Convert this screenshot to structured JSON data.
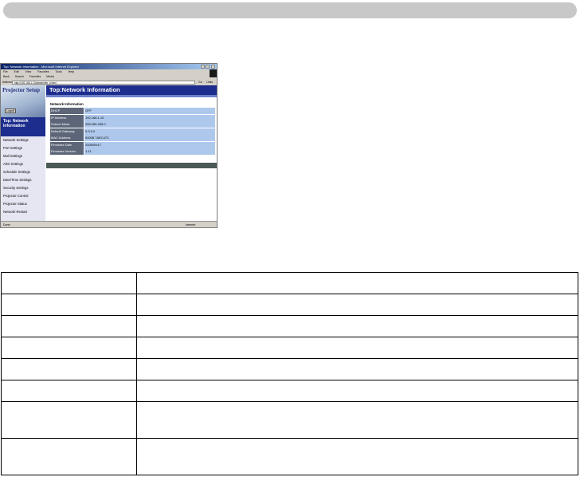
{
  "window": {
    "title": "Top: Network Information - Microsoft Internet Explorer",
    "menu": [
      "File",
      "Edit",
      "View",
      "Favorites",
      "Tools",
      "Help"
    ],
    "toolbar": [
      "Back",
      "Search",
      "Favorites",
      "Media"
    ],
    "address_label": "Address",
    "address_value": "http://192.168.1.10/admin/info_d.html",
    "go_label": "Go",
    "links_label": "Links"
  },
  "sidebar": {
    "title": "Projector Setup",
    "logoff_label": "Logoff",
    "current": "Top: Network Information",
    "items": [
      "Network Settings",
      "Port Settings",
      "Mail Settings",
      "Alert Settings",
      "Schedule Settings",
      "Date/Time Settings",
      "Security Settings",
      "Projector Control",
      "Projector Status",
      "Network Restart"
    ]
  },
  "main": {
    "header": "Top:Network Information",
    "section_title": "Network Information",
    "rows": [
      {
        "key": "DHCP",
        "value": "OFF"
      },
      {
        "key": "IP Address",
        "value": "192.168.1.10"
      },
      {
        "key": "Subnet Mask",
        "value": "255.255.255.0"
      },
      {
        "key": "Default Gateway",
        "value": "0.0.0.0"
      },
      {
        "key": "MAC Address",
        "value": "00008 7AEC47C"
      },
      {
        "key": "Firmware Date",
        "value": "2005/09/17"
      },
      {
        "key": "Firmware Version",
        "value": "1.11"
      }
    ]
  },
  "statusbar": {
    "left": "Done",
    "right": "Internet"
  }
}
